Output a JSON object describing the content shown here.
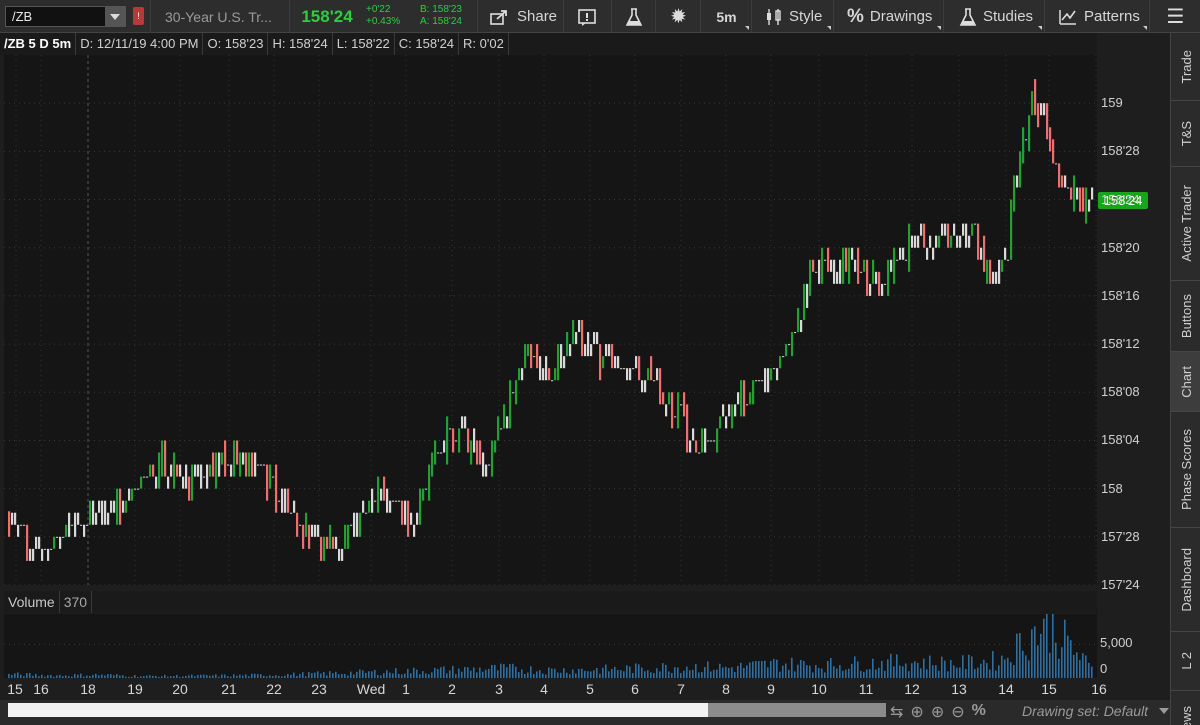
{
  "toolbar": {
    "symbol": "/ZB",
    "flag": "!",
    "description": "30-Year U.S. Tr...",
    "last_price": "158'24",
    "net_change": "+0'22",
    "pct_change": "+0.43%",
    "bid": "B: 158'23",
    "ask": "A: 158'24",
    "share_label": "Share",
    "timeframe": "5m",
    "style_label": "Style",
    "drawings_label": "Drawings",
    "studies_label": "Studies",
    "patterns_label": "Patterns"
  },
  "infobar": {
    "symbol": "/ZB 5 D 5m",
    "date": "D: 12/11/19 4:00 PM",
    "open": "O: 158'23",
    "high": "H: 158'24",
    "low": "L: 158'22",
    "close": "C: 158'24",
    "range": "R: 0'02"
  },
  "price_axis": {
    "labels": [
      "159",
      "158'28",
      "158'24",
      "158'20",
      "158'16",
      "158'12",
      "158'08",
      "158'04",
      "158",
      "157'28",
      "157'24"
    ],
    "last_tag": "158'24"
  },
  "volume": {
    "label": "Volume",
    "value": "370",
    "axis_labels": [
      "5,000",
      "0"
    ]
  },
  "time_axis": {
    "labels": [
      "15",
      "16",
      "18",
      "19",
      "20",
      "21",
      "22",
      "23",
      "Wed",
      "1",
      "2",
      "3",
      "4",
      "5",
      "6",
      "7",
      "8",
      "9",
      "10",
      "11",
      "12",
      "13",
      "14",
      "15",
      "16"
    ]
  },
  "bottom": {
    "drawing_set": "Drawing set: Default"
  },
  "side_tabs": [
    "Trade",
    "T&S",
    "Active Trader",
    "Buttons",
    "Chart",
    "Phase Scores",
    "Dashboard",
    "L 2",
    "News"
  ],
  "colors": {
    "up_bar": "#23a033",
    "down_bar": "#ef6f6f",
    "flat_bar": "#d9d9d9",
    "price_green": "#2ecc40",
    "volume_bar": "#2f6f9f"
  },
  "chart_data": {
    "type": "ohlc",
    "title": "/ZB 5 D 5m",
    "y_unit": "32nds",
    "ylim": [
      157.75,
      159.125
    ],
    "yticks_decimal": [
      159.0,
      158.875,
      158.75,
      158.625,
      158.5,
      158.375,
      158.25,
      158.125,
      158.0,
      157.875,
      157.75
    ],
    "last_value": 158.75,
    "price_path": [
      157.91,
      157.86,
      157.84,
      157.86,
      157.9,
      157.92,
      157.95,
      157.95,
      157.97,
      158.02,
      158.08,
      158.04,
      158.02,
      158.03,
      158.06,
      158.08,
      158.08,
      158.05,
      158.0,
      157.93,
      157.9,
      157.86,
      157.86,
      157.9,
      157.95,
      157.98,
      157.96,
      157.92,
      158.0,
      158.1,
      158.16,
      158.12,
      158.06,
      158.14,
      158.26,
      158.36,
      158.28,
      158.34,
      158.4,
      158.38,
      158.33,
      158.3,
      158.32,
      158.28,
      158.25,
      158.2,
      158.12,
      158.1,
      158.18,
      158.22,
      158.25,
      158.3,
      158.34,
      158.42,
      158.56,
      158.6,
      158.57,
      158.58,
      158.56,
      158.54,
      158.6,
      158.64,
      158.62,
      158.66,
      158.64,
      158.68,
      158.55,
      158.62,
      158.85,
      159.02,
      158.9,
      158.78,
      158.75,
      158.73
    ],
    "volume_peak": 8800,
    "volume_typical": [
      600,
      400,
      500,
      300,
      350,
      400,
      500,
      700,
      900,
      1100,
      1300,
      1500,
      1200,
      1300,
      1500,
      1800,
      1600,
      2200,
      2000,
      2300,
      2500,
      2200,
      2800,
      8800,
      1400
    ]
  }
}
